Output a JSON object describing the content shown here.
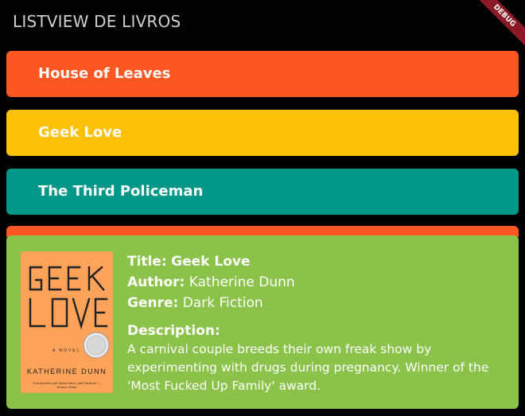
{
  "appbar": {
    "title": "LISTVIEW DE LIVROS"
  },
  "debug_banner": {
    "label": "DEBUG",
    "color": "#8b1a24"
  },
  "books": [
    {
      "title": "House of Leaves",
      "color": "#ff5722"
    },
    {
      "title": "Geek Love",
      "color": "#ffc107"
    },
    {
      "title": "The Third Policeman",
      "color": "#009688"
    }
  ],
  "peek_tile": {
    "color": "#ff5722"
  },
  "detail": {
    "color": "#8bc34a",
    "title_label": "Title:",
    "title": "Geek Love",
    "author_label": "Author:",
    "author": "Katherine Dunn",
    "genre_label": "Genre:",
    "genre": "Dark Fiction",
    "description_label": "Description:",
    "description": "A carnival couple breeds their own freak show by experimenting with drugs during pregnancy. Winner of the 'Most Fucked Up Family' award.",
    "cover": {
      "title_line1": "GEEK",
      "title_line2": "LOVE",
      "novel_text": "A NOVEL",
      "author": "KATHERINE DUNN",
      "blurb": "\"A book that's part Diane Arbus, part Faulkner\" — Boston Globe",
      "background": "#ffa25a"
    }
  }
}
